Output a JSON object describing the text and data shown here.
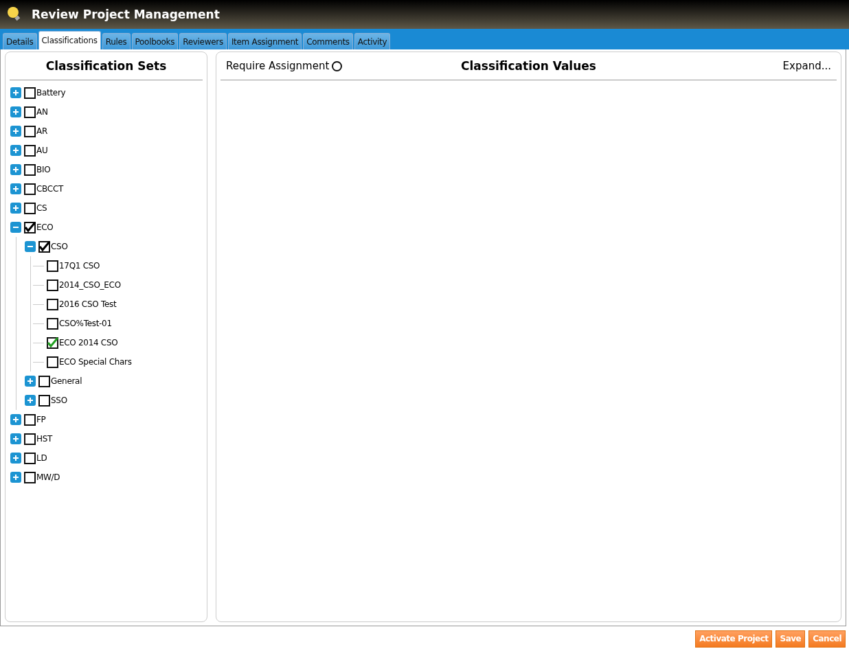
{
  "window": {
    "title": "Review Project Management"
  },
  "tabs": [
    {
      "label": "Details",
      "selected": false
    },
    {
      "label": "Classifications",
      "selected": true
    },
    {
      "label": "Rules",
      "selected": false
    },
    {
      "label": "Poolbooks",
      "selected": false
    },
    {
      "label": "Reviewers",
      "selected": false
    },
    {
      "label": "Item Assignment",
      "selected": false
    },
    {
      "label": "Comments",
      "selected": false
    },
    {
      "label": "Activity",
      "selected": false
    }
  ],
  "classification_sets": {
    "title": "Classification Sets",
    "items": [
      {
        "label": "Battery",
        "expanded": false,
        "checked": false
      },
      {
        "label": "AN",
        "expanded": false,
        "checked": false
      },
      {
        "label": "AR",
        "expanded": false,
        "checked": false
      },
      {
        "label": "AU",
        "expanded": false,
        "checked": false
      },
      {
        "label": "BIO",
        "expanded": false,
        "checked": false
      },
      {
        "label": "CBCCT",
        "expanded": false,
        "checked": false
      },
      {
        "label": "CS",
        "expanded": false,
        "checked": false
      },
      {
        "label": "ECO",
        "expanded": true,
        "checked": true,
        "children": [
          {
            "label": "CSO",
            "expanded": true,
            "checked": true,
            "children": [
              {
                "label": "17Q1 CSO",
                "checked": false
              },
              {
                "label": "2014_CSO_ECO",
                "checked": false
              },
              {
                "label": "2016 CSO Test",
                "checked": false
              },
              {
                "label": "CSO%Test-01",
                "checked": false
              },
              {
                "label": "ECO 2014 CSO",
                "checked": true
              },
              {
                "label": "ECO Special Chars",
                "checked": false
              }
            ]
          },
          {
            "label": "General",
            "expanded": false,
            "checked": false
          },
          {
            "label": "SSO",
            "expanded": false,
            "checked": false
          }
        ]
      },
      {
        "label": "FP",
        "expanded": false,
        "checked": false
      },
      {
        "label": "HST",
        "expanded": false,
        "checked": false
      },
      {
        "label": "LD",
        "expanded": false,
        "checked": false
      },
      {
        "label": "MW/D",
        "expanded": false,
        "checked": false
      }
    ]
  },
  "classification_values": {
    "require_assignment": {
      "label": "Require Assignment",
      "checked": false
    },
    "title": "Classification Values",
    "expand_link": "Expand..."
  },
  "buttons": [
    "Activate Project",
    "Save",
    "Cancel"
  ]
}
